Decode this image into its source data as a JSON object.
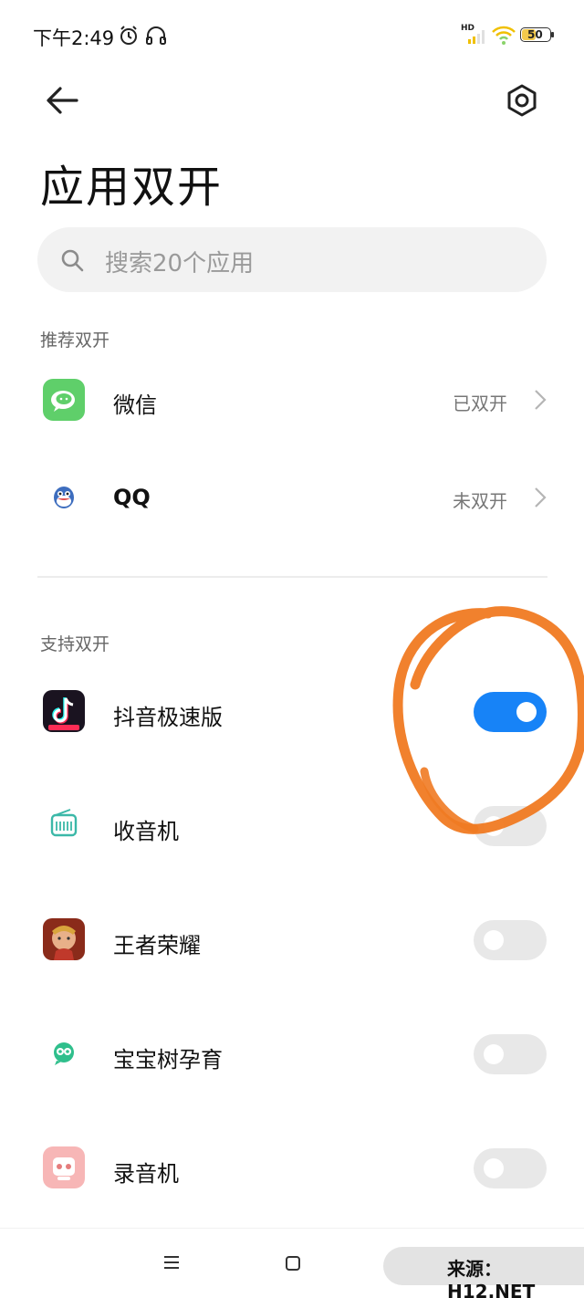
{
  "status_bar": {
    "time": "下午2:49",
    "icons": [
      "alarm-icon",
      "headphones-icon",
      "signal-hd-icon",
      "wifi-icon",
      "battery-icon"
    ],
    "signal_label": "HD",
    "battery": "50"
  },
  "nav": {
    "back_icon": "back-arrow-icon",
    "settings_icon": "gear-hexagon-icon"
  },
  "page": {
    "title": "应用双开"
  },
  "search": {
    "placeholder": "搜索20个应用"
  },
  "recommended": {
    "header": "推荐双开",
    "items": [
      {
        "name": "微信",
        "status": "已双开",
        "icon": "wechat-icon"
      },
      {
        "name": "QQ",
        "status": "未双开",
        "icon": "qq-icon"
      }
    ]
  },
  "supported": {
    "header": "支持双开",
    "items": [
      {
        "name": "抖音极速版",
        "enabled": true,
        "icon": "douyin-lite-icon"
      },
      {
        "name": "收音机",
        "enabled": false,
        "icon": "radio-icon"
      },
      {
        "name": "王者荣耀",
        "enabled": false,
        "icon": "honor-of-kings-icon"
      },
      {
        "name": "宝宝树孕育",
        "enabled": false,
        "icon": "babytree-icon"
      },
      {
        "name": "录音机",
        "enabled": false,
        "icon": "recorder-icon"
      }
    ]
  },
  "colors": {
    "toggle_on": "#1783f7",
    "annotation": "#f07a22",
    "wechat": "#5fcf6a"
  },
  "nav_bar": {
    "icons": [
      "menu-nav-icon",
      "home-nav-icon"
    ]
  },
  "watermark": {
    "text": "来源：H12.NET"
  }
}
